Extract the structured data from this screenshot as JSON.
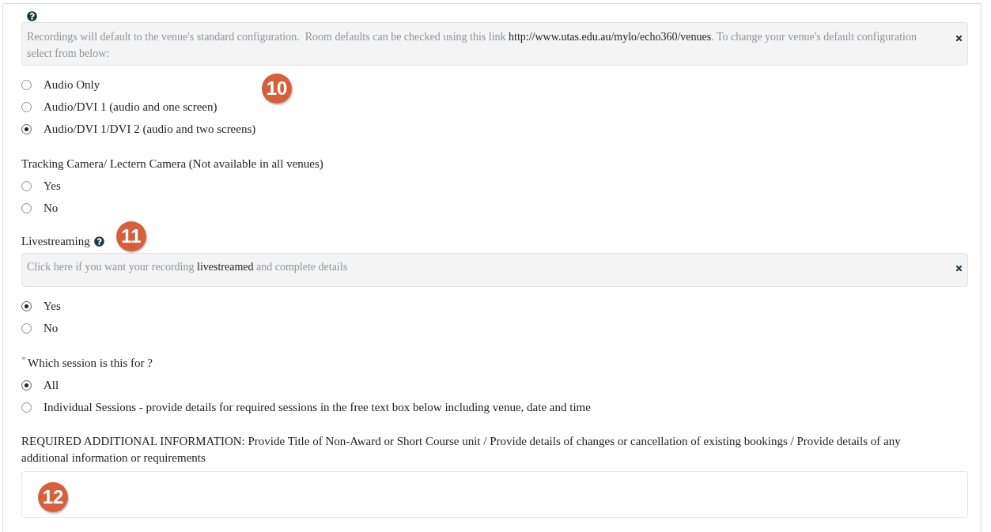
{
  "recording_configuration": {
    "callout": "10",
    "notice": {
      "before": "Recordings will default to the venue's standard configuration.  Room defaults can be checked using this link ",
      "link": "http://www.utas.edu.au/mylo/echo360/venues",
      "after": ". To change your venue's default configuration select from below:"
    },
    "options": [
      {
        "label": "Audio Only",
        "selected": false
      },
      {
        "label": "Audio/DVI 1 (audio and one screen)",
        "selected": false
      },
      {
        "label": "Audio/DVI 1/DVI 2 (audio and two screens)",
        "selected": true
      }
    ]
  },
  "tracking_camera": {
    "label": "Tracking Camera/ Lectern Camera (Not available in all venues)",
    "options": [
      {
        "label": "Yes",
        "selected": false
      },
      {
        "label": "No",
        "selected": false
      }
    ]
  },
  "livestreaming": {
    "label": "Livestreaming",
    "callout": "11",
    "notice": {
      "before": "Click here if you want your recording ",
      "link": "livestreamed",
      "after": " and complete details"
    },
    "options": [
      {
        "label": "Yes",
        "selected": true
      },
      {
        "label": "No",
        "selected": false
      }
    ]
  },
  "session": {
    "required_mark": "*",
    "label": "Which session is this for ?",
    "options": [
      {
        "label": "All",
        "selected": true
      },
      {
        "label": "Individual Sessions - provide details for required sessions in the free text box below including venue, date and time",
        "selected": false
      }
    ]
  },
  "additional_information": {
    "label": "REQUIRED ADDITIONAL INFORMATION: Provide Title of Non-Award or Short Course unit / Provide details of changes or cancellation of existing bookings / Provide details of any additional information or requirements",
    "callout": "12"
  }
}
